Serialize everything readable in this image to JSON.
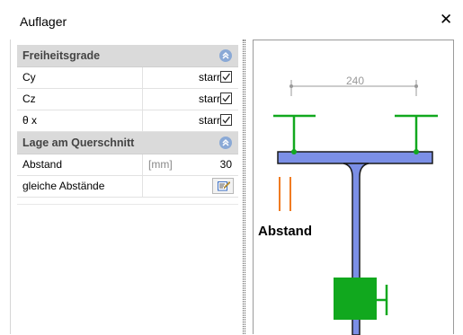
{
  "window": {
    "title": "Auflager",
    "close_glyph": "✕"
  },
  "sections": {
    "freiheitsgrade": {
      "label": "Freiheitsgrade"
    },
    "lage": {
      "label": "Lage am Querschnitt"
    }
  },
  "freiheitsgrade_rows": [
    {
      "name": "Cy",
      "value": "starr",
      "checked": true
    },
    {
      "name": "Cz",
      "value": "starr",
      "checked": true
    },
    {
      "name": "θ x",
      "value": "starr",
      "checked": true
    }
  ],
  "lage_rows": {
    "abstand": {
      "name": "Abstand",
      "unit": "[mm]",
      "value": "30"
    },
    "gleiche": {
      "name": "gleiche Abstände"
    }
  },
  "diagram": {
    "dimension_label": "240",
    "abstand_label": "Abstand",
    "colors": {
      "beam": "#7b8fe6",
      "support": "#11a81e",
      "marker": "#f07b22",
      "dim": "#999999"
    }
  }
}
